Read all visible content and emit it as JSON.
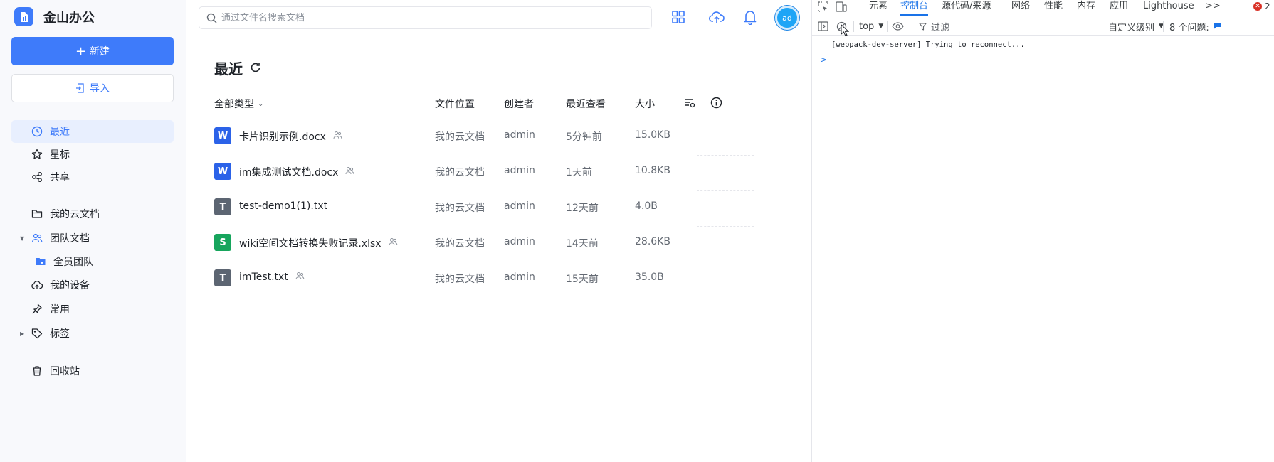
{
  "app": {
    "name": "金山办公",
    "new_label": "新建",
    "import_label": "导入"
  },
  "nav": {
    "recent": "最近",
    "starred": "星标",
    "shared": "共享",
    "my_docs": "我的云文档",
    "team_docs": "团队文档",
    "all_team": "全员团队",
    "my_devices": "我的设备",
    "frequent": "常用",
    "tags": "标签",
    "recycle": "回收站"
  },
  "search": {
    "placeholder": "通过文件名搜索文档"
  },
  "avatar": {
    "initials": "ad"
  },
  "page": {
    "title": "最近"
  },
  "table": {
    "headers": {
      "type": "全部类型",
      "location": "文件位置",
      "creator": "创建者",
      "viewed": "最近查看",
      "size": "大小"
    },
    "rows": [
      {
        "icon": "W",
        "kind": "word",
        "name": "卡片识别示例.docx",
        "shared": true,
        "location": "我的云文档",
        "creator": "admin",
        "viewed": "5分钟前",
        "size": "15.0KB"
      },
      {
        "icon": "W",
        "kind": "word",
        "name": "im集成测试文档.docx",
        "shared": true,
        "location": "我的云文档",
        "creator": "admin",
        "viewed": "1天前",
        "size": "10.8KB"
      },
      {
        "icon": "T",
        "kind": "text",
        "name": "test-demo1(1).txt",
        "shared": false,
        "location": "我的云文档",
        "creator": "admin",
        "viewed": "12天前",
        "size": "4.0B"
      },
      {
        "icon": "S",
        "kind": "sheet",
        "name": "wiki空间文档转换失败记录.xlsx",
        "shared": true,
        "location": "我的云文档",
        "creator": "admin",
        "viewed": "14天前",
        "size": "28.6KB"
      },
      {
        "icon": "T",
        "kind": "text",
        "name": "imTest.txt",
        "shared": true,
        "location": "我的云文档",
        "creator": "admin",
        "viewed": "15天前",
        "size": "35.0B"
      }
    ]
  },
  "devtools": {
    "tabs": [
      "元素",
      "控制台",
      "源代码/来源",
      "网络",
      "性能",
      "内存",
      "应用",
      "Lighthouse"
    ],
    "active_tab": "控制台",
    "more": ">>",
    "errors": "2",
    "context": "top",
    "filter": "过滤",
    "level": "自定义级别",
    "issues": "8 个问题:",
    "console_message": "[webpack-dev-server] Trying to reconnect...",
    "prompt": ">"
  },
  "colors": {
    "accent": "#3e7bfa",
    "word": "#2b62e8",
    "text": "#5c6572",
    "sheet": "#17a55d",
    "devtools_accent": "#1a73e8"
  }
}
